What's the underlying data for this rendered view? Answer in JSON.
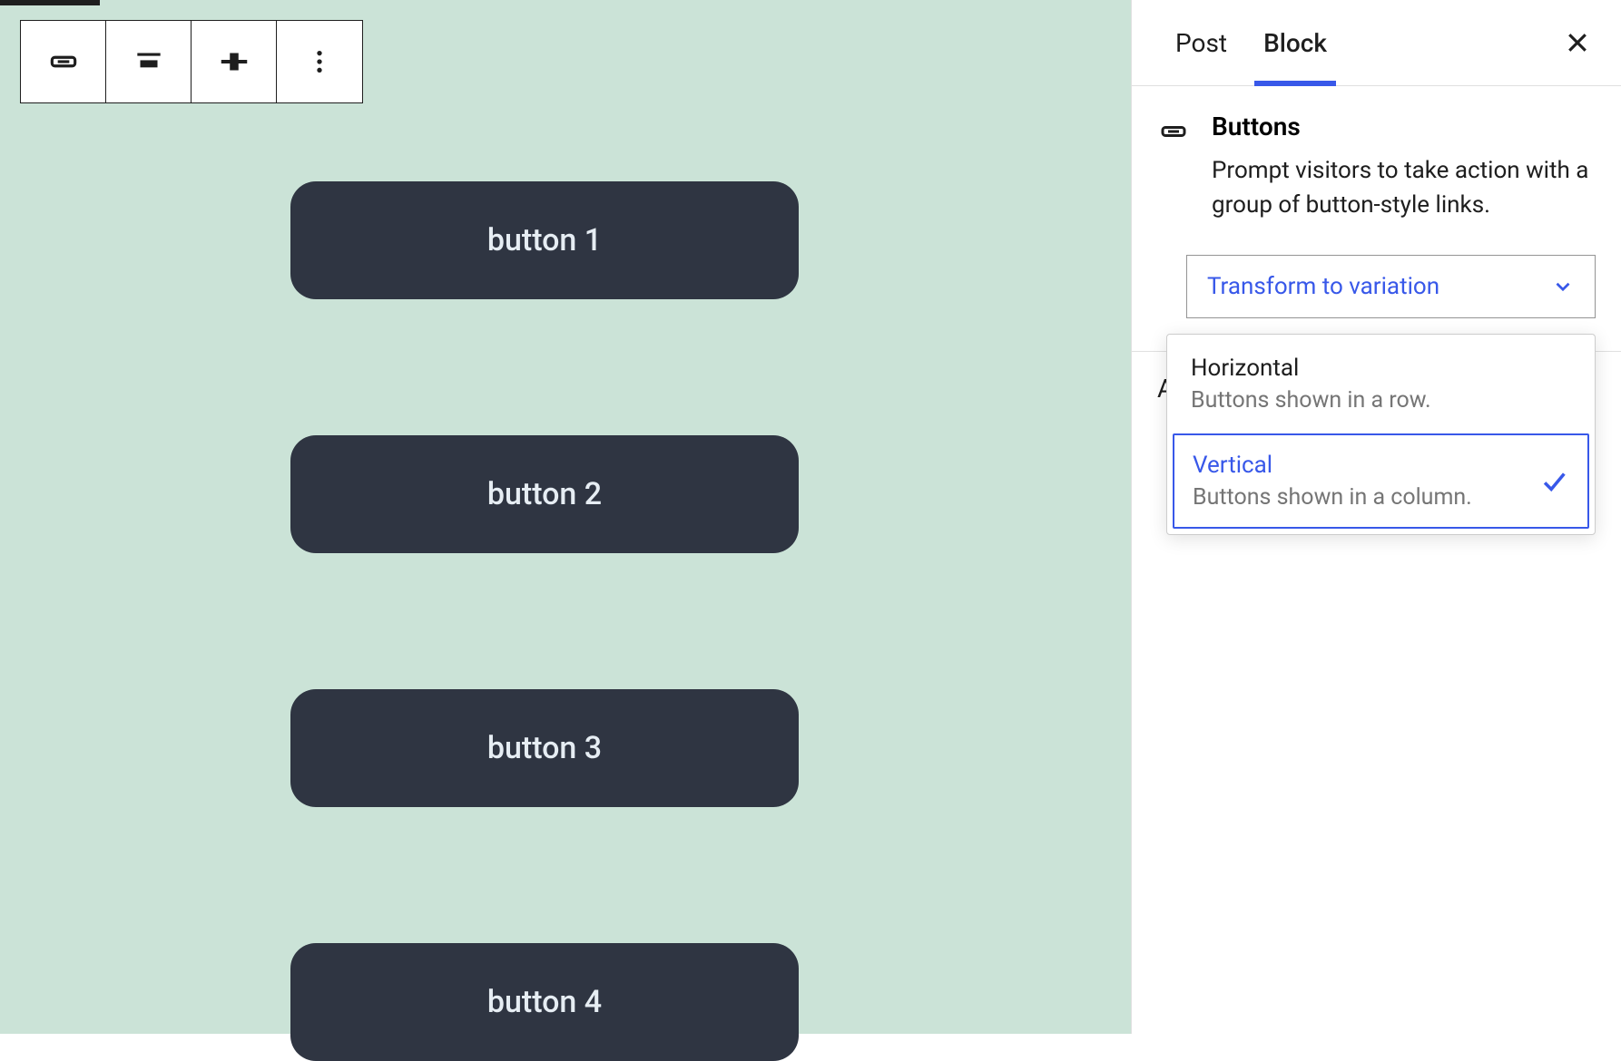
{
  "canvas": {
    "buttons": [
      "button 1",
      "button 2",
      "button 3",
      "button 4"
    ]
  },
  "sidebar": {
    "tabs": {
      "post": "Post",
      "block": "Block"
    },
    "active_tab": "Block",
    "block": {
      "title": "Buttons",
      "description": "Prompt visitors to take action with a group of button-style links."
    },
    "transform_label": "Transform to variation",
    "advanced_label": "Advanced",
    "variations": [
      {
        "title": "Horizontal",
        "desc": "Buttons shown in a row.",
        "active": false
      },
      {
        "title": "Vertical",
        "desc": "Buttons shown in a column.",
        "active": true
      }
    ]
  }
}
